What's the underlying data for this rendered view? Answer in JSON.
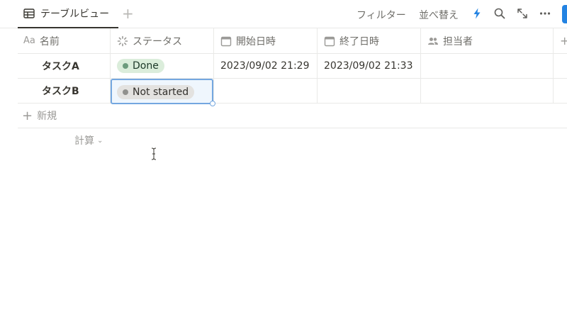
{
  "topbar": {
    "view_tab_label": "テーブルビュー",
    "add_view": "+",
    "filter_label": "フィルター",
    "sort_label": "並べ替え"
  },
  "table": {
    "columns": [
      {
        "icon": "text-icon",
        "icon_text": "Aa",
        "label": "名前"
      },
      {
        "icon": "status-icon",
        "label": "ステータス"
      },
      {
        "icon": "calendar-icon",
        "label": "開始日時"
      },
      {
        "icon": "calendar-icon",
        "label": "終了日時"
      },
      {
        "icon": "people-icon",
        "label": "担当者"
      }
    ],
    "add_column": "+",
    "rows": [
      {
        "name": "タスクA",
        "status": "Done",
        "start": "2023/09/02 21:29",
        "end": "2023/09/02 21:33",
        "assignee": ""
      },
      {
        "name": "タスクB",
        "status": "Not started",
        "start": "",
        "end": "",
        "assignee": ""
      }
    ],
    "new_row_label": "新規",
    "calc_label": "計算"
  },
  "colors": {
    "accent": "#2383e2",
    "done_bg": "#dbeddb",
    "done_dot": "#6c9b7d",
    "not_started_bg": "#e3e2e0",
    "not_started_dot": "#91918e"
  }
}
